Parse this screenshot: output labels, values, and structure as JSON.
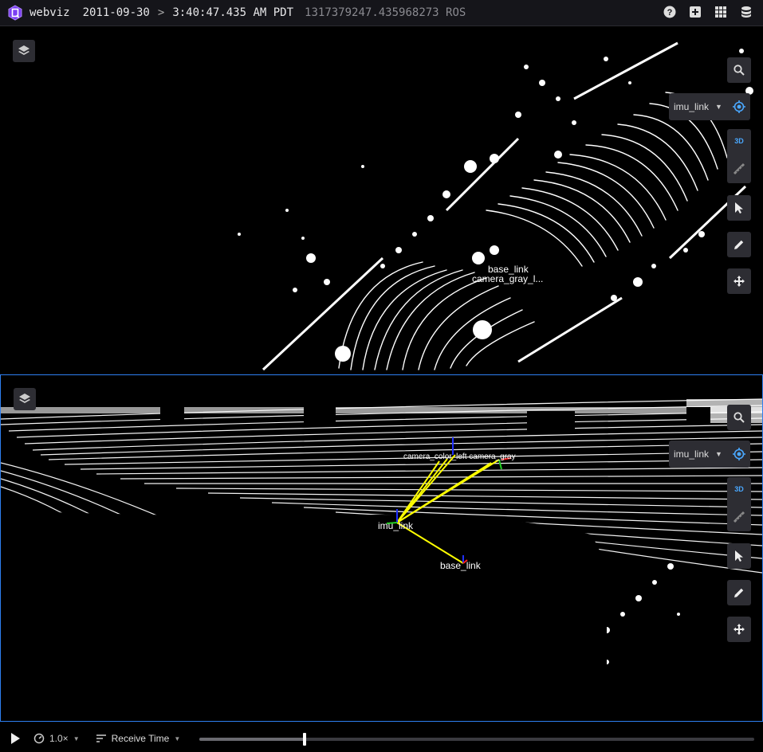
{
  "topbar": {
    "app_name": "webviz",
    "date": "2011-09-30",
    "separator": ">",
    "time": "3:40:47.435 AM PDT",
    "ros_time": "1317379247.435968273 ROS",
    "icons": [
      "help-icon",
      "add-panel-icon",
      "layout-grid-icon",
      "data-source-icon"
    ]
  },
  "top_panel": {
    "follow_frame": "imu_link",
    "mode_label": "3D",
    "tools": [
      "search-icon",
      "target-icon",
      "select-cursor-icon",
      "pencil-icon",
      "move-icon"
    ],
    "frame_labels": [
      {
        "id": "base",
        "text": "base_link"
      },
      {
        "id": "camera",
        "text": "camera_gray_l..."
      }
    ]
  },
  "bottom_panel": {
    "follow_frame": "imu_link",
    "mode_label": "3D",
    "frame_labels": [
      {
        "id": "imu",
        "text": "imu_link"
      },
      {
        "id": "base",
        "text": "base_link"
      },
      {
        "id": "cams",
        "text": "camera_color_left  camera_gray"
      }
    ]
  },
  "playback": {
    "speed": "1.0×",
    "time_mode": "Receive Time",
    "progress_fraction": 0.19
  },
  "colors": {
    "accent": "#2e7ff0",
    "toolbar_bg": "#2d2d33",
    "axis_yellow": "#ffff00"
  }
}
